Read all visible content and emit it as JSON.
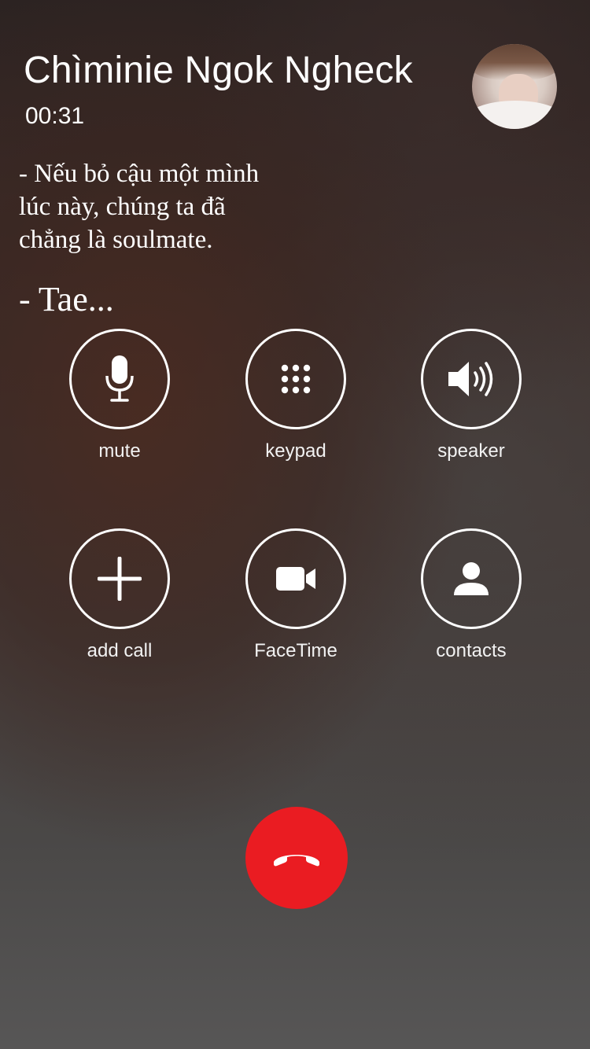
{
  "call": {
    "caller_name": "Chìminie Ngok Ngheck",
    "duration": "00:31",
    "avatar_icon": "contact-photo"
  },
  "overlay_text": {
    "line1": "- Nếu bỏ cậu một mình",
    "line2": "lúc này, chúng ta đã",
    "line3": "chẳng là soulmate.",
    "line4": "- Tae..."
  },
  "controls": {
    "mute": {
      "label": "mute",
      "icon": "microphone-icon"
    },
    "keypad": {
      "label": "keypad",
      "icon": "keypad-icon"
    },
    "speaker": {
      "label": "speaker",
      "icon": "speaker-icon"
    },
    "add_call": {
      "label": "add call",
      "icon": "plus-icon"
    },
    "facetime": {
      "label": "FaceTime",
      "icon": "video-camera-icon"
    },
    "contacts": {
      "label": "contacts",
      "icon": "person-icon"
    }
  },
  "end_call": {
    "icon": "phone-hangup-icon",
    "color": "#ea1c22"
  }
}
